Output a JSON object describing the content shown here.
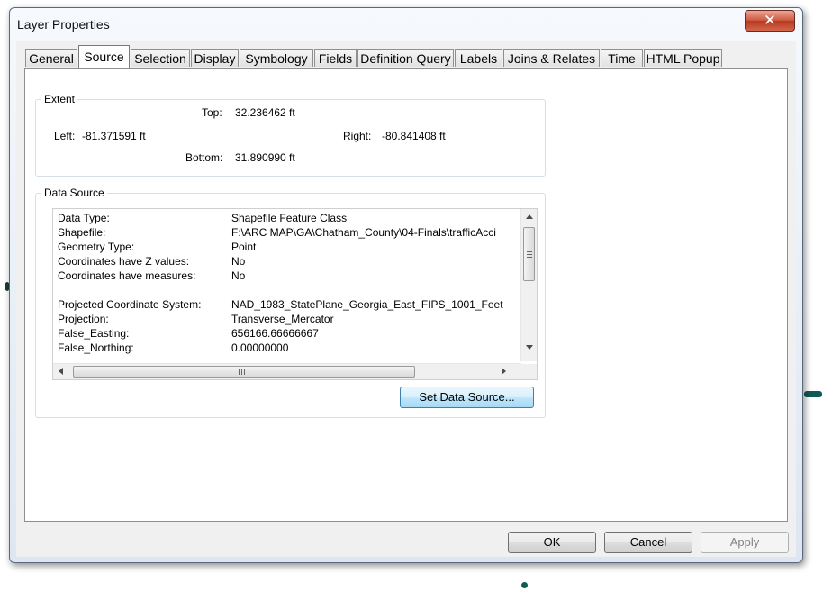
{
  "window": {
    "title": "Layer Properties"
  },
  "tabs": [
    {
      "label": "General"
    },
    {
      "label": "Source",
      "active": true
    },
    {
      "label": "Selection"
    },
    {
      "label": "Display"
    },
    {
      "label": "Symbology"
    },
    {
      "label": "Fields"
    },
    {
      "label": "Definition Query"
    },
    {
      "label": "Labels"
    },
    {
      "label": "Joins & Relates"
    },
    {
      "label": "Time"
    },
    {
      "label": "HTML Popup"
    }
  ],
  "extent": {
    "group_label": "Extent",
    "top_label": "Top:",
    "top_value": "32.236462 ft",
    "left_label": "Left:",
    "left_value": "-81.371591 ft",
    "right_label": "Right:",
    "right_value": "-80.841408 ft",
    "bottom_label": "Bottom:",
    "bottom_value": "31.890990 ft"
  },
  "data_source": {
    "group_label": "Data Source",
    "rows": [
      {
        "key": "Data Type:",
        "value": "Shapefile Feature Class"
      },
      {
        "key": "Shapefile:",
        "value": "F:\\ARC MAP\\GA\\Chatham_County\\04-Finals\\trafficAcci"
      },
      {
        "key": "Geometry Type:",
        "value": "Point"
      },
      {
        "key": "Coordinates have Z values:",
        "value": "No"
      },
      {
        "key": "Coordinates have measures:",
        "value": "No"
      },
      {
        "key": "",
        "value": ""
      },
      {
        "key": "Projected Coordinate System:",
        "value": "NAD_1983_StatePlane_Georgia_East_FIPS_1001_Feet"
      },
      {
        "key": "Projection:",
        "value": "Transverse_Mercator"
      },
      {
        "key": "False_Easting:",
        "value": "656166.66666667"
      },
      {
        "key": "False_Northing:",
        "value": "0.00000000"
      }
    ],
    "set_button": "Set Data Source..."
  },
  "buttons": {
    "ok": "OK",
    "cancel": "Cancel",
    "apply": "Apply"
  },
  "colors": {
    "focus_border": "#3c7fb1",
    "close_red": "#c84a32"
  }
}
